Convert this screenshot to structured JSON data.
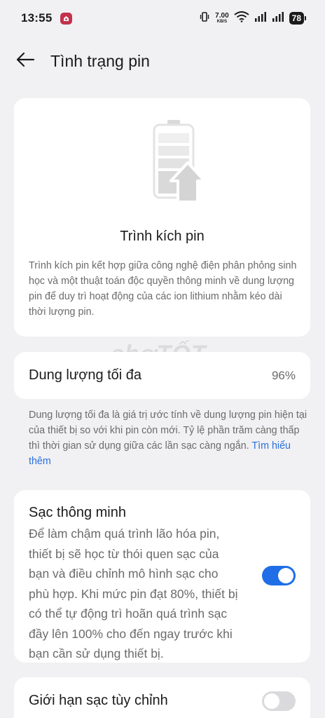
{
  "status_bar": {
    "time": "13:55",
    "net_speed_value": "7.00",
    "net_speed_unit": "KB/S",
    "battery_level": "78",
    "icons": [
      "app-badge-icon",
      "vibrate-icon",
      "wifi-icon",
      "signal-icon",
      "signal-icon",
      "battery-icon"
    ]
  },
  "header": {
    "title": "Tình trạng pin",
    "back_icon": "arrow-left-icon"
  },
  "calibration_card": {
    "icon": "battery-calibration-icon",
    "title": "Trình kích pin",
    "description": "Trình kích pin kết hợp giữa công nghệ điện phân phỏng sinh học và một thuật toán độc quyền thông minh về dung lượng pin để duy trì hoạt động của các ion lithium nhằm kéo dài thời lượng pin."
  },
  "max_capacity": {
    "label": "Dung lượng tối đa",
    "value": "96%"
  },
  "capacity_note": {
    "text": "Dung lượng tối đa là giá trị ước tính về dung lượng pin hiện tại của thiết bị so với khi pin còn mới. Tỷ lệ phần trăm càng thấp thì thời gian sử dụng giữa các lần sạc càng ngắn.",
    "link": "Tìm hiểu thêm"
  },
  "smart_charging": {
    "title": "Sạc thông minh",
    "description": "Để làm chậm quá trình lão hóa pin, thiết bị sẽ học từ thói quen sạc của bạn và điều chỉnh mô hình sạc cho phù hợp. Khi mức pin đạt 80%, thiết bị có thể tự động trì hoãn quá trình sạc đầy lên 100% cho đến ngay trước khi bạn cần sử dụng thiết bị.",
    "enabled": true
  },
  "custom_limit": {
    "title": "Giới hạn sạc tùy chỉnh",
    "enabled": false
  },
  "watermark": "chợTỐT",
  "colors": {
    "background": "#f1f1f3",
    "card": "#ffffff",
    "accent": "#1f6ee8",
    "link": "#2b6fdc",
    "secondary_text": "#6b6b6b",
    "toggle_off": "#dadadd"
  }
}
